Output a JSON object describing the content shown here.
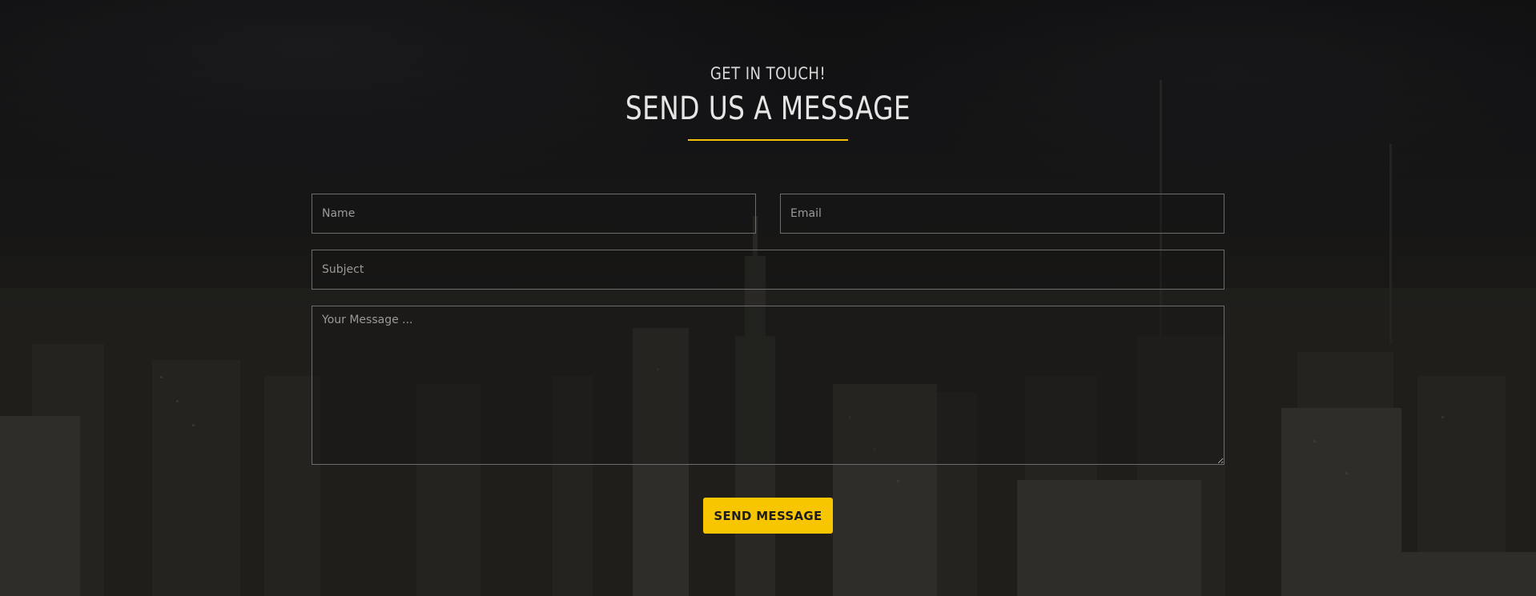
{
  "section": {
    "eyebrow": "GET IN TOUCH!",
    "title": "SEND US A MESSAGE",
    "accent_color": "#f5c000"
  },
  "form": {
    "name_placeholder": "Name",
    "email_placeholder": "Email",
    "subject_placeholder": "Subject",
    "message_placeholder": "Your Message ...",
    "submit_label": "SEND MESSAGE",
    "submit_color": "#f7c600"
  },
  "background": {
    "description_icon": "city-skyline-image"
  }
}
